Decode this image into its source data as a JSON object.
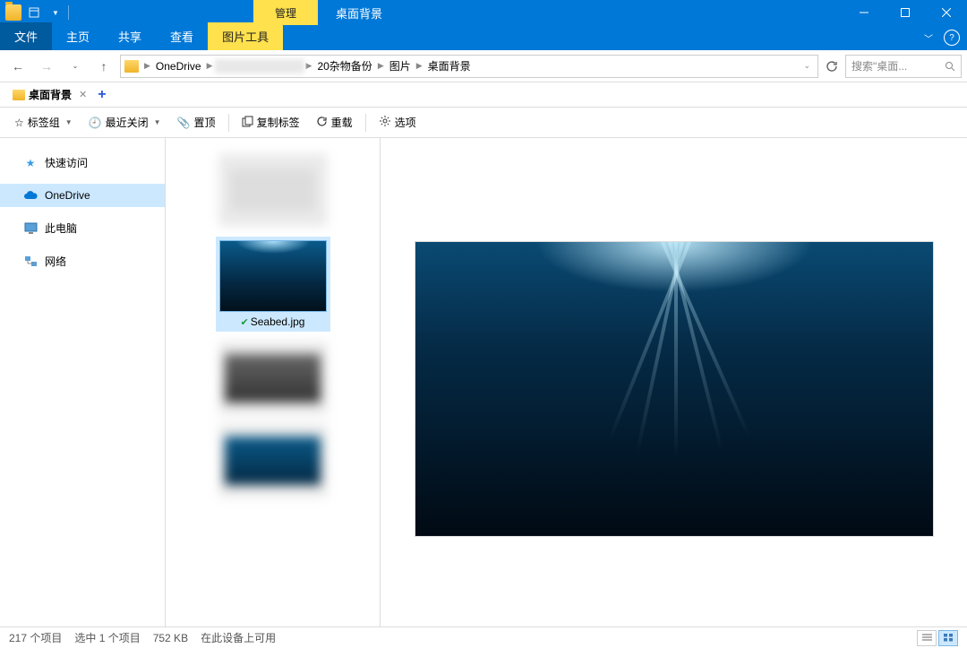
{
  "title_bar": {
    "context_tab": "管理",
    "window_title": "桌面背景"
  },
  "ribbon": {
    "file": "文件",
    "home": "主页",
    "share": "共享",
    "view": "查看",
    "picture_tools": "图片工具"
  },
  "breadcrumb": {
    "items": [
      "OneDrive",
      "",
      "20杂物备份",
      "图片",
      "桌面背景"
    ]
  },
  "search": {
    "placeholder": "搜索\"桌面..."
  },
  "folder_tab": {
    "name": "桌面背景"
  },
  "toolbar": {
    "bookmark_group": "标签组",
    "recent_close": "最近关闭",
    "pin_top": "置顶",
    "copy_tab": "复制标签",
    "reload": "重载",
    "options": "选项"
  },
  "sidebar": {
    "items": [
      {
        "label": "快速访问",
        "icon": "star"
      },
      {
        "label": "OneDrive",
        "icon": "cloud",
        "selected": true
      },
      {
        "label": "此电脑",
        "icon": "pc"
      },
      {
        "label": "网络",
        "icon": "network"
      }
    ]
  },
  "files": {
    "selected_name": "Seabed.jpg"
  },
  "status": {
    "count": "217 个项目",
    "selected": "选中 1 个项目",
    "size": "752 KB",
    "availability": "在此设备上可用"
  }
}
